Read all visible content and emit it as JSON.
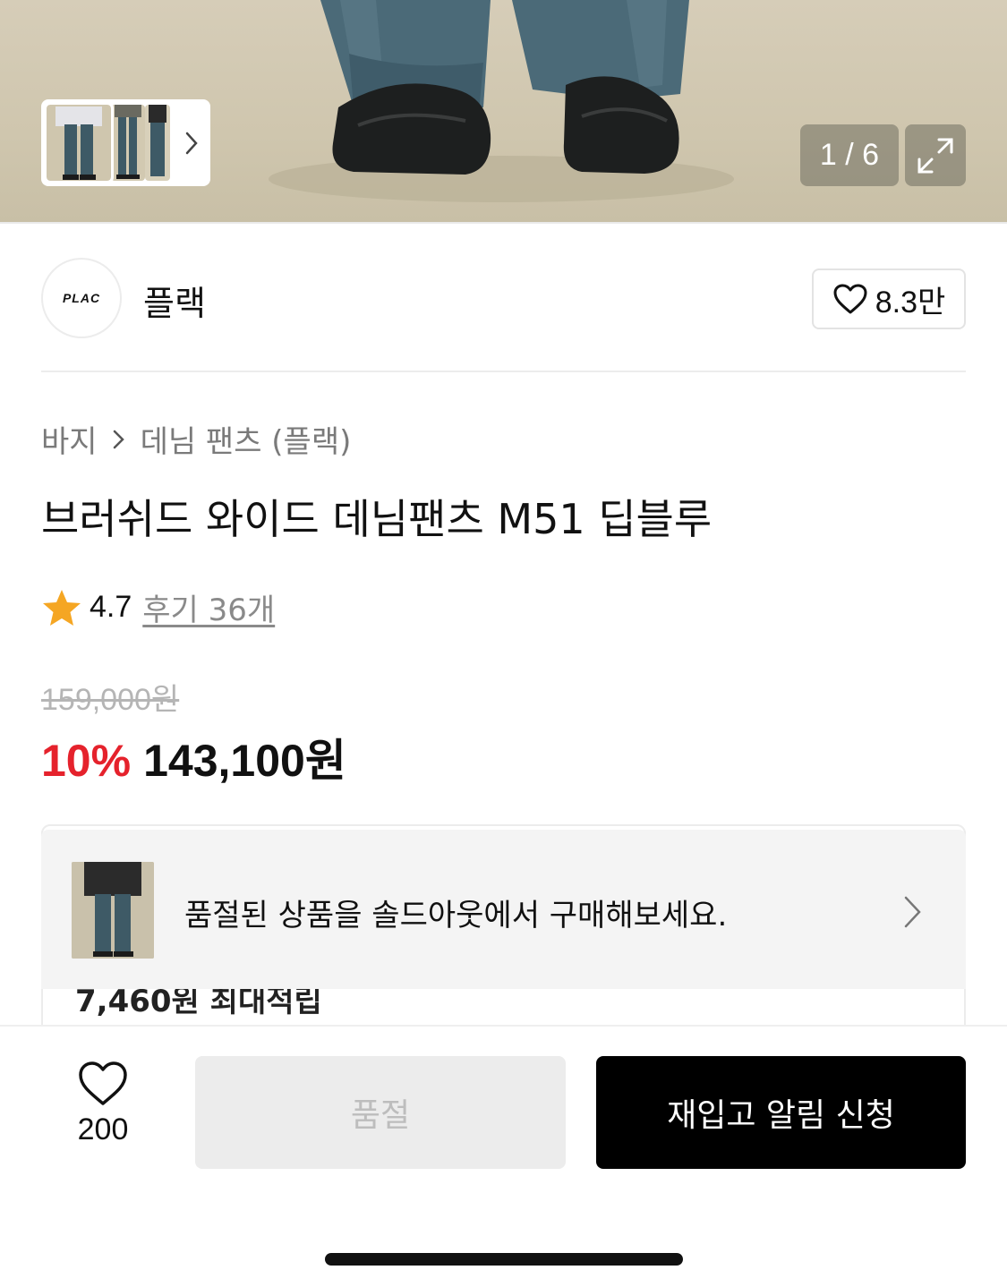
{
  "gallery": {
    "counter": "1 / 6",
    "thumbnails": [
      "product-photo-1",
      "product-photo-2",
      "product-photo-3"
    ],
    "icons": {
      "next": "chevron-right-icon",
      "expand": "expand-icon"
    }
  },
  "brand": {
    "logo_text": "PLAC",
    "name": "플랙",
    "like_count": "8.3만",
    "like_icon": "heart-outline-icon"
  },
  "product": {
    "breadcrumb": [
      "바지",
      "데님 팬츠 (플랙)"
    ],
    "title": "브러쉬드 와이드 데님팬츠 M51 딥블루",
    "rating": "4.7",
    "review_link": "후기 36개",
    "original_price": "159,000원",
    "discount_rate": "10%",
    "sale_price": "143,100원"
  },
  "banner": {
    "text": "품절된 상품을 솔드아웃에서 구매해보세요.",
    "partial_text_behind": "7,460원 최대적립"
  },
  "bottom_bar": {
    "wish_count": "200",
    "soldout_label": "품절",
    "restock_label": "재입고 알림 신청"
  },
  "colors": {
    "discount": "#e5222c",
    "primary_button": "#000000",
    "disabled_button": "#ececec",
    "star": "#f5a623"
  }
}
